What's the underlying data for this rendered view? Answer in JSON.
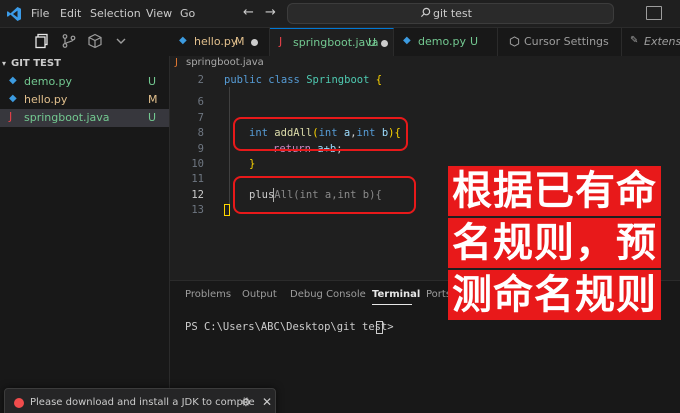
{
  "menu": [
    "File",
    "Edit",
    "Selection",
    "View",
    "Go"
  ],
  "search": {
    "text": "git test"
  },
  "sidebar": {
    "section_title": "GIT TEST",
    "files": [
      {
        "name": "demo.py",
        "badge": "U",
        "icon": "python-icon",
        "color": "#73c991"
      },
      {
        "name": "hello.py",
        "badge": "M",
        "icon": "python-icon",
        "color": "#e2c08d"
      },
      {
        "name": "springboot.java",
        "badge": "U",
        "icon": "java-icon",
        "color": "#73c991"
      }
    ]
  },
  "tabs": [
    {
      "label": "hello.py",
      "badge": "M"
    },
    {
      "label": "springboot.java",
      "badge": "U"
    },
    {
      "label": "demo.py",
      "badge": "U"
    },
    {
      "label": "Cursor Settings"
    },
    {
      "label": "Extensio"
    }
  ],
  "breadcrumb": {
    "file": "springboot.java"
  },
  "editor": {
    "line_numbers": [
      "2",
      "6",
      "7",
      "8",
      "9",
      "10",
      "11",
      "12",
      "13"
    ],
    "current_line": "12",
    "line2": {
      "kw1": "public",
      "kw2": "class",
      "name": "Springboot",
      "brace": "{"
    },
    "line8": {
      "type": "int",
      "name": "addAll",
      "open": "(",
      "t1": "int",
      "p1": "a",
      "comma": ",",
      "t2": "int",
      "p2": "b",
      "close": ")",
      "brace": "{"
    },
    "line9": {
      "kw": "return",
      "expr": "a+b",
      "semi": ";"
    },
    "line10": {
      "brace": "}"
    },
    "line12": {
      "typed": "plus",
      "ghost": "All(int a,int b){"
    }
  },
  "panel": {
    "tabs": [
      "Problems",
      "Output",
      "Debug Console",
      "Terminal",
      "Ports"
    ],
    "active_tab": "Terminal",
    "terminal_prompt": "PS C:\\Users\\ABC\\Desktop\\git test> "
  },
  "notification": {
    "message": "Please download and install a JDK to compile"
  },
  "overlay": {
    "lines": [
      "根据已有命",
      "名规则，预",
      "测命名规则"
    ]
  },
  "colors": {
    "accent": "#0078d4",
    "highlight": "#e8191a"
  }
}
